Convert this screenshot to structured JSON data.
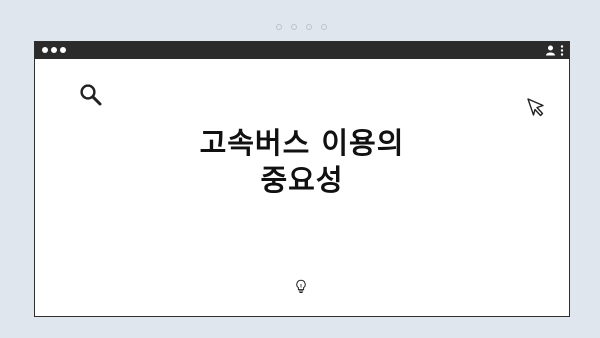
{
  "window": {
    "titlebar_color": "#2b2b2b",
    "background": "#ffffff"
  },
  "icons": {
    "search": "search-icon",
    "cursor": "cursor-icon",
    "lightbulb": "lightbulb-icon",
    "profile": "profile-icon",
    "menu": "kebab-menu-icon"
  },
  "content": {
    "title_line1": "고속버스 이용의",
    "title_line2": "중요성"
  }
}
